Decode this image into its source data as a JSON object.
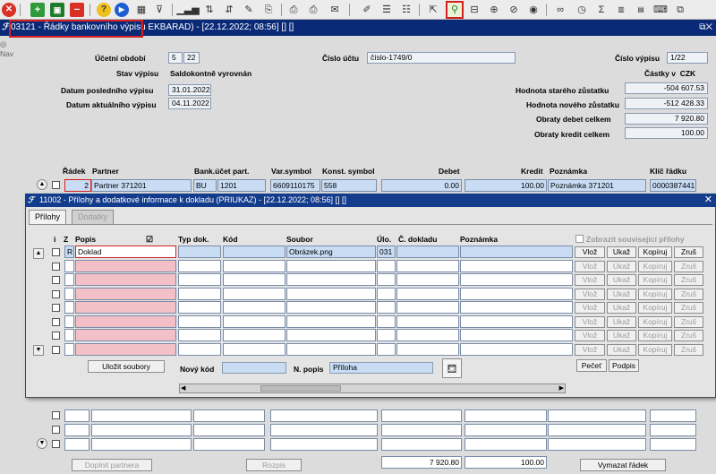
{
  "toolbar": {
    "icons": [
      "close-icon",
      "add-icon",
      "save-icon",
      "remove-icon",
      "help-icon",
      "next-icon",
      "calendar-icon",
      "filter-icon",
      "bar-chart-icon",
      "sort-asc-icon",
      "sort-desc-icon",
      "pencil-wrench-icon",
      "copy-icon",
      "print-icon",
      "print-preview-icon",
      "email-icon",
      "edit-icon",
      "list-icon",
      "list-detail-icon",
      "export-icon",
      "attachment-icon",
      "fork-icon",
      "globe-icon",
      "compass-icon",
      "eye-icon",
      "glasses-icon",
      "clock-icon",
      "sigma-icon",
      "excel-icon",
      "word-icon",
      "keyboard-icon",
      "network-icon"
    ]
  },
  "main_window": {
    "title": "03121 - Řádky bankovního výpisu",
    "title_rest": " EKBARAD) - [22.12.2022; 08:56]  [] []",
    "side_label": "Nav",
    "fields": {
      "ucetni_obdobi_label": "Účetní období",
      "ucetni_obdobi_a": "5",
      "ucetni_obdobi_b": "22",
      "cislo_uctu_label": "Číslo účtu",
      "cislo_uctu": "číslo-1749/0",
      "cislo_vypisu_label": "Číslo výpisu",
      "cislo_vypisu": "1/22",
      "stav_vypisu_label": "Stav výpisu",
      "stav_vypisu": "Saldokontně vyrovnán",
      "castky_v_label": "Částky v",
      "currency": "CZK",
      "datum_posledniho_label": "Datum posledního výpisu",
      "datum_posledniho": "31.01.2022",
      "hodnota_stareho_label": "Hodnota starého zůstatku",
      "hodnota_stareho": "-504 607.53",
      "hodnota_noveho_label": "Hodnota nového zůstatku",
      "hodnota_noveho": "-512 428.33",
      "datum_aktualniho_label": "Datum aktuálního výpisu",
      "datum_aktualniho": "04.11.2022",
      "obraty_debet_label": "Obraty debet celkem",
      "obraty_debet": "7 920.80",
      "obraty_kredit_label": "Obraty kredit celkem",
      "obraty_kredit": "100.00"
    },
    "columns": [
      "Řádek",
      "Partner",
      "Bank.účet part.",
      "Var.symbol",
      "Konst. symbol",
      "Debet",
      "Kredit",
      "Poznámka",
      "Klíč řádku"
    ],
    "row": {
      "radek": "2",
      "partner": "Partner 371201",
      "bank_a": "BU",
      "bank_b": "1201",
      "var_symbol": "6609110175",
      "konst_symbol": "558",
      "debet": "0.00",
      "kredit": "100.00",
      "poznamka": "Poznámka 371201",
      "klic": "0000387441"
    },
    "totals": {
      "debet": "7 920.80",
      "kredit": "100.00"
    },
    "buttons": {
      "doplnit": "Doplnit partnera",
      "rozpis": "Rozpis",
      "vymazat": "Vymazat řádek"
    }
  },
  "dialog": {
    "title": "11002 - Přílohy a dodatkové informace k dokladu (PRIUKAZ) - [22.12.2022; 08:56]  [] []",
    "tabs": [
      "Přílohy",
      "Dodatky"
    ],
    "columns": {
      "i": "i",
      "z": "Z",
      "popis": "Popis",
      "typ": "Typ dok.",
      "kod": "Kód",
      "soubor": "Soubor",
      "ulo": "Úlo.",
      "cislo": "Č. dokladu",
      "poznamka": "Poznámka"
    },
    "show_related_label": "Zobrazit související přílohy",
    "row1": {
      "z": "R",
      "popis": "Doklad",
      "soubor": "Obrázek.png",
      "ulo": "031"
    },
    "row_buttons": {
      "vloz": "Vlož",
      "ukaz": "Ukaž",
      "kopiruj": "Kopíruj",
      "zrus": "Zruš"
    },
    "ulozit_label": "Uložit soubory",
    "novy_kod_label": "Nový kód",
    "novy_kod": "",
    "n_popis_label": "N. popis",
    "n_popis": "Příloha",
    "pecet": "Pečeť",
    "podpis": "Podpis"
  },
  "colors": {
    "title_bar": "#0a2a78",
    "highlight": "#d62020",
    "selected_row": "#c8dcf4",
    "required": "#f4c0c8"
  }
}
